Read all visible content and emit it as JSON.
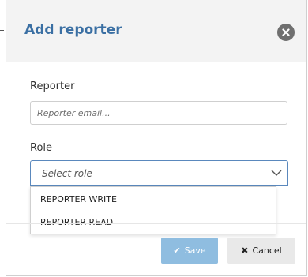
{
  "dialog": {
    "title": "Add reporter"
  },
  "form": {
    "reporter_label": "Reporter",
    "reporter_placeholder": "Reporter email...",
    "reporter_value": "",
    "role_label": "Role",
    "role_selected": "Select role",
    "role_options": [
      {
        "label": "REPORTER WRITE"
      },
      {
        "label": "REPORTER READ"
      }
    ]
  },
  "footer": {
    "save_label": "Save",
    "cancel_label": "Cancel"
  },
  "icons": {
    "close": "close-icon",
    "chevron": "chevron-down-icon",
    "save": "check-icon",
    "cancel": "x-icon"
  },
  "colors": {
    "title": "#3a6fa3",
    "save_button": "#8fbde0",
    "cancel_button": "#e9e9e9",
    "select_focus_border": "#5a88bd"
  }
}
